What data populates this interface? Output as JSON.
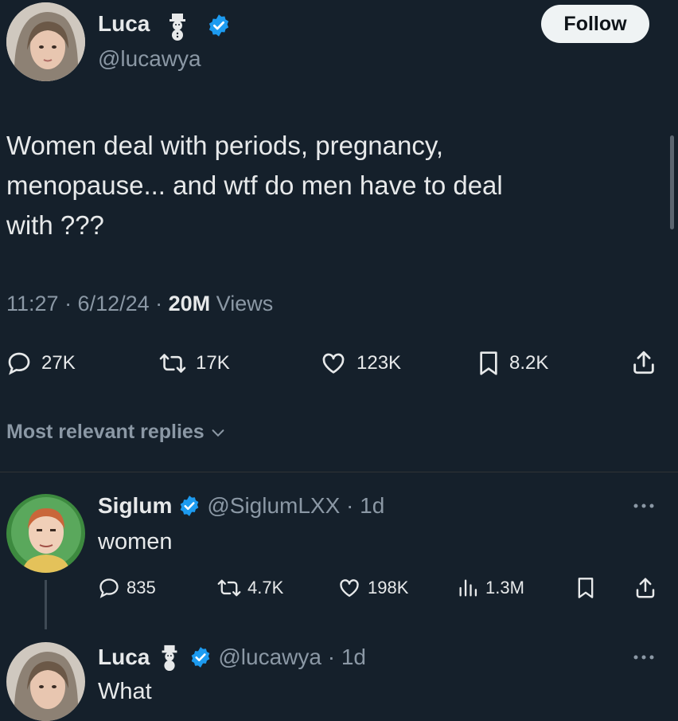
{
  "tweet": {
    "author_name": "Luca",
    "author_handle": "@lucawya",
    "follow_label": "Follow",
    "text_lines": [
      "Women deal with periods, pregnancy,",
      "menopause... and wtf do men have to deal",
      "with ???"
    ],
    "time": "11:27 · 6/12/24 · ",
    "views_count": "20M",
    "views_label": " Views",
    "stats": {
      "replies": "27K",
      "reposts": "17K",
      "likes": "123K",
      "bookmarks": "8.2K"
    }
  },
  "sort": {
    "label": "Most relevant replies"
  },
  "replies": [
    {
      "author_name": "Siglum",
      "author_handle": "@SiglumLXX",
      "time": " · 1d",
      "text": "women",
      "stats": {
        "replies": "835",
        "reposts": "4.7K",
        "likes": "198K",
        "views": "1.3M"
      }
    },
    {
      "author_name": "Luca",
      "author_handle": "@lucawya",
      "time": " · 1d",
      "text": "What"
    }
  ],
  "colors": {
    "background": "#15202b",
    "verified": "#1d9bf0",
    "muted": "#8b98a5"
  }
}
